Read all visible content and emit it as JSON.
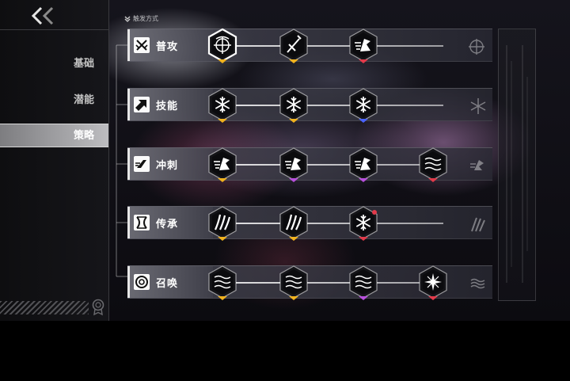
{
  "sidebar": {
    "back_icon": "double-chevron-left-icon",
    "items": [
      {
        "label": "基础",
        "active": false
      },
      {
        "label": "潜能",
        "active": false
      },
      {
        "label": "策略",
        "active": true
      }
    ],
    "bottom_icon": "medal-icon"
  },
  "trigger_label": "触发方式",
  "colors": {
    "gold": "#f0b21e",
    "purple": "#b84fdc",
    "blue": "#4a63ff",
    "red": "#e23a4a"
  },
  "rows": [
    {
      "label": "普攻",
      "icon": "crossed-swords-icon",
      "end_icon": "bow-target-icon",
      "nodes": [
        {
          "icon": "bow-target-icon",
          "tier": "gold",
          "selected": true
        },
        {
          "icon": "sword-strike-icon",
          "tier": "gold"
        },
        {
          "icon": "dash-burst-icon",
          "tier": "red"
        }
      ]
    },
    {
      "label": "技能",
      "icon": "arrow-up-right-icon",
      "end_icon": "snowflake-icon",
      "nodes": [
        {
          "icon": "snowflake-icon",
          "tier": "gold"
        },
        {
          "icon": "snowflake-icon",
          "tier": "gold"
        },
        {
          "icon": "snowflake-icon",
          "tier": "blue"
        }
      ]
    },
    {
      "label": "冲刺",
      "icon": "dash-run-icon",
      "end_icon": "dash-burst-icon",
      "nodes": [
        {
          "icon": "dash-burst-icon",
          "tier": "gold"
        },
        {
          "icon": "dash-burst-icon",
          "tier": "purple"
        },
        {
          "icon": "dash-burst-icon",
          "tier": "purple"
        },
        {
          "icon": "wind-waves-icon",
          "tier": "red"
        }
      ]
    },
    {
      "label": "传承",
      "icon": "hourglass-icon",
      "end_icon": "claw-slash-icon",
      "nodes": [
        {
          "icon": "claw-slash-icon",
          "tier": "gold"
        },
        {
          "icon": "claw-slash-icon",
          "tier": "gold"
        },
        {
          "icon": "snowflake-icon",
          "tier": "red",
          "flag": true
        }
      ]
    },
    {
      "label": "召唤",
      "icon": "spiral-summon-icon",
      "end_icon": "wind-waves-icon",
      "nodes": [
        {
          "icon": "wind-waves-icon",
          "tier": "gold"
        },
        {
          "icon": "wind-waves-icon",
          "tier": "gold"
        },
        {
          "icon": "wind-waves-icon",
          "tier": "purple"
        },
        {
          "icon": "star-snowflake-icon",
          "tier": "red"
        }
      ]
    }
  ]
}
